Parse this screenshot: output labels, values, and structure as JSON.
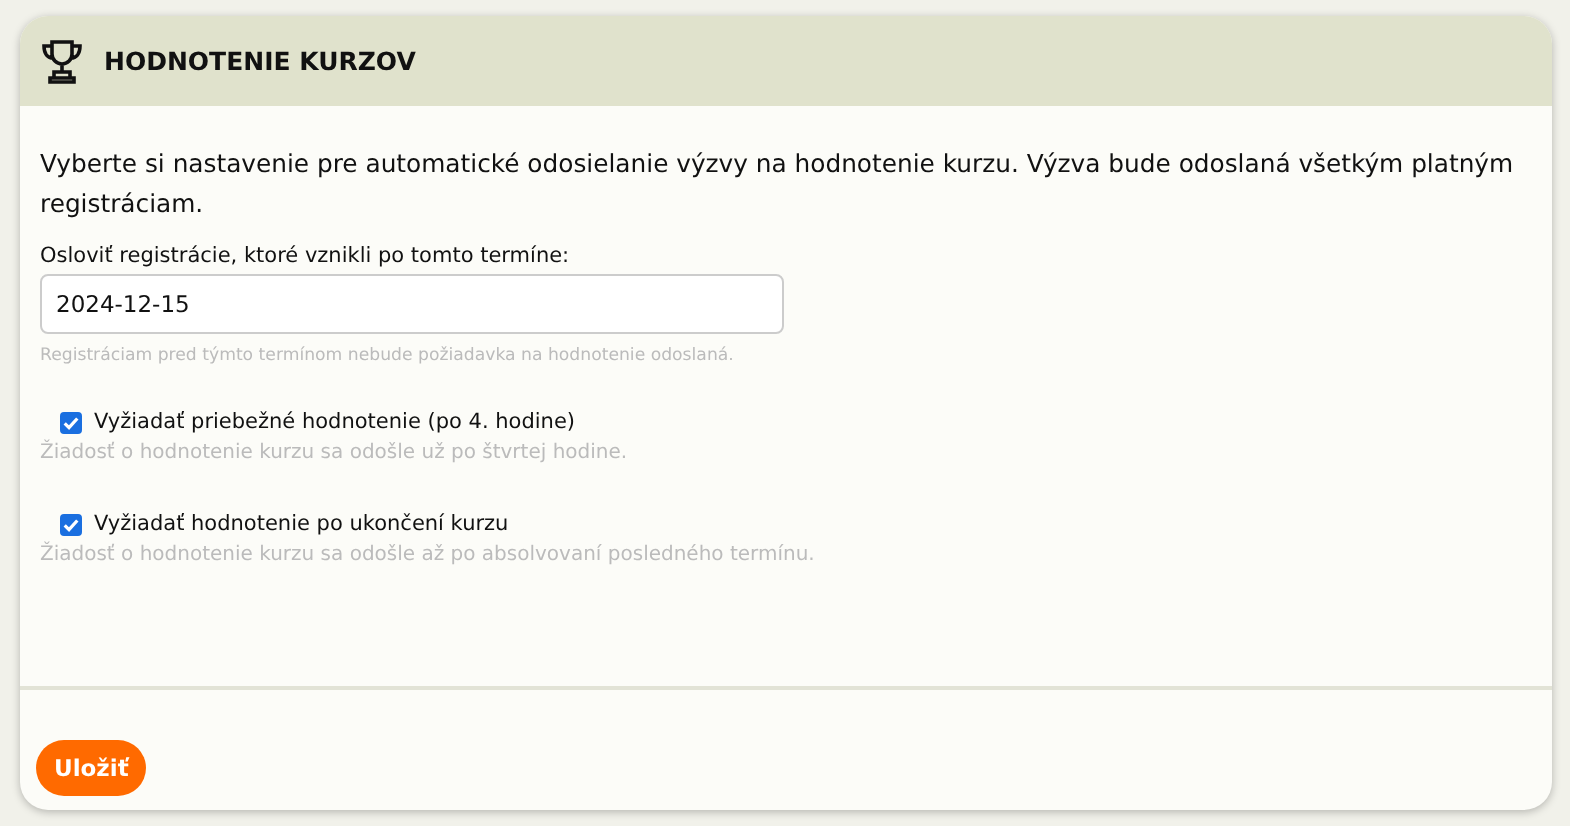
{
  "card": {
    "title": "HODNOTENIE KURZOV",
    "intro": "Vyberte si nastavenie pre automatické odosielanie výzvy na hodnotenie kurzu. Výzva bude odoslaná všetkým platným registráciam.",
    "date_field": {
      "label": "Osloviť registrácie, ktoré vznikli po tomto termíne:",
      "value": "2024-12-15",
      "hint": "Registráciam pred týmto termínom nebude požiadavka na hodnotenie odoslaná."
    },
    "options": [
      {
        "label": "Vyžiadať priebežné hodnotenie (po 4. hodine)",
        "checked": true,
        "hint": "Žiadosť o hodnotenie kurzu sa odošle už po štvrtej hodine."
      },
      {
        "label": "Vyžiadať hodnotenie po ukončení kurzu",
        "checked": true,
        "hint": "Žiadosť o hodnotenie kurzu sa odošle až po absolvovaní posledného termínu."
      }
    ],
    "save_button": "Uložiť"
  }
}
